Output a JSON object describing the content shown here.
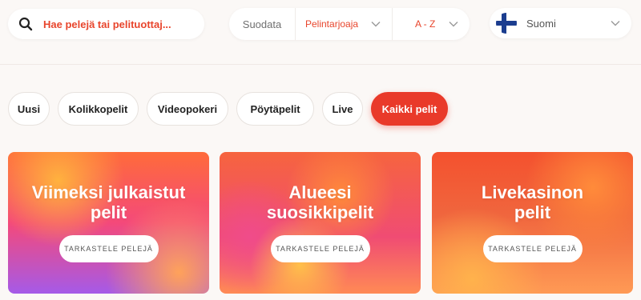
{
  "search": {
    "placeholder": "Hae pelejä tai pelituottaj...",
    "icon": "search-icon"
  },
  "filters": {
    "label": "Suodata",
    "provider": "Pelintarjoaja",
    "sort": "A - Z"
  },
  "language": {
    "label": "Suomi",
    "flag": "finland-flag-icon"
  },
  "categories": [
    {
      "label": "Uusi",
      "active": false
    },
    {
      "label": "Kolikkopelit",
      "active": false
    },
    {
      "label": "Videopokeri",
      "active": false
    },
    {
      "label": "Pöytäpelit",
      "active": false
    },
    {
      "label": "Live",
      "active": false
    },
    {
      "label": "Kaikki pelit",
      "active": true
    }
  ],
  "cards": [
    {
      "title": "Viimeksi julkaistut\npelit",
      "button": "TARKASTELE PELEJÄ"
    },
    {
      "title": "Alueesi\nsuosikkipelit",
      "button": "TARKASTELE PELEJÄ"
    },
    {
      "title": "Livekasinon\npelit",
      "button": "TARKASTELE PELEJÄ"
    }
  ],
  "colors": {
    "accent": "#e93a2a",
    "background": "#fbf8f6"
  }
}
